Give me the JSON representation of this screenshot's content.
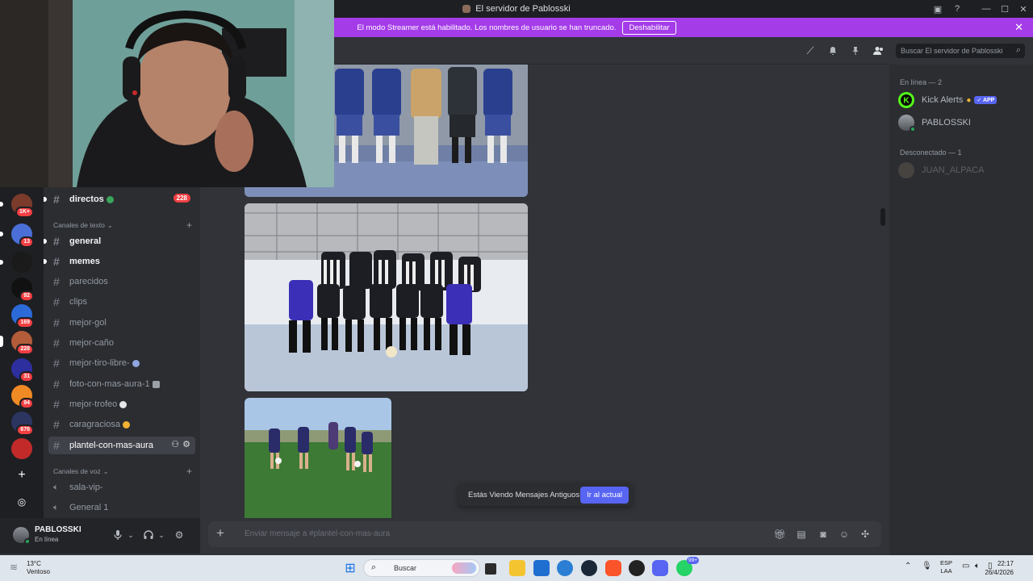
{
  "window": {
    "title": "El servidor de Pablosski"
  },
  "banner": {
    "message": "El modo Streamer está habilitado. Los nombres de usuario se han truncado.",
    "button": "Deshabilitar"
  },
  "servers": [
    {
      "badge": "1K+"
    },
    {
      "badge": "13"
    },
    {
      "badge": ""
    },
    {
      "badge": "92"
    },
    {
      "badge": "169"
    },
    {
      "badge": "228"
    },
    {
      "badge": "31"
    },
    {
      "badge": "94"
    },
    {
      "badge": "676"
    },
    {
      "badge": ""
    }
  ],
  "sidebar": {
    "top_channel": {
      "name": "directos",
      "count": "228"
    },
    "text_category": "Canales de texto",
    "channels": [
      {
        "name": "general"
      },
      {
        "name": "memes"
      },
      {
        "name": "parecidos"
      },
      {
        "name": "clips"
      },
      {
        "name": "mejor-gol"
      },
      {
        "name": "mejor-caño"
      },
      {
        "name": "mejor-tiro-libre-"
      },
      {
        "name": "foto-con-mas-aura-1"
      },
      {
        "name": "mejor-trofeo"
      },
      {
        "name": "caragraciosa"
      },
      {
        "name": "plantel-con-mas-aura"
      }
    ],
    "voice_category": "Canales de voz",
    "voice_channels": [
      {
        "name": "sala-vip-"
      },
      {
        "name": "General 1"
      }
    ]
  },
  "user": {
    "name": "PABLOSSKI",
    "status": "En línea"
  },
  "header": {
    "search_placeholder": "Buscar El servidor de Pablosski"
  },
  "old_messages": {
    "text": "Estás Viendo Mensajes Antiguos",
    "button": "Ir al actual"
  },
  "composer": {
    "placeholder": "Enviar mensaje a #plantel-con-mas-aura"
  },
  "members": {
    "online_header": "En línea — 2",
    "online": [
      {
        "name": "Kick Alerts",
        "tag": "✓ APP"
      },
      {
        "name": "PABLOSSKI",
        "tag": ""
      }
    ],
    "offline_header": "Desconectado — 1",
    "offline": [
      {
        "name": "JUAN_ALPACA"
      }
    ]
  },
  "taskbar": {
    "temperature": "13°C",
    "weather": "Ventoso",
    "search": "Buscar",
    "discord_badge": "99+",
    "lang_top": "ESP",
    "lang_bottom": "LAA",
    "time": "22:17",
    "date": "26/4/2026"
  },
  "colors": {
    "streamer_banner": "#a43ce8",
    "accent": "#5865f2",
    "mention_badge": "#f23f43",
    "online": "#23a55a",
    "kick_green": "#53fc18"
  }
}
